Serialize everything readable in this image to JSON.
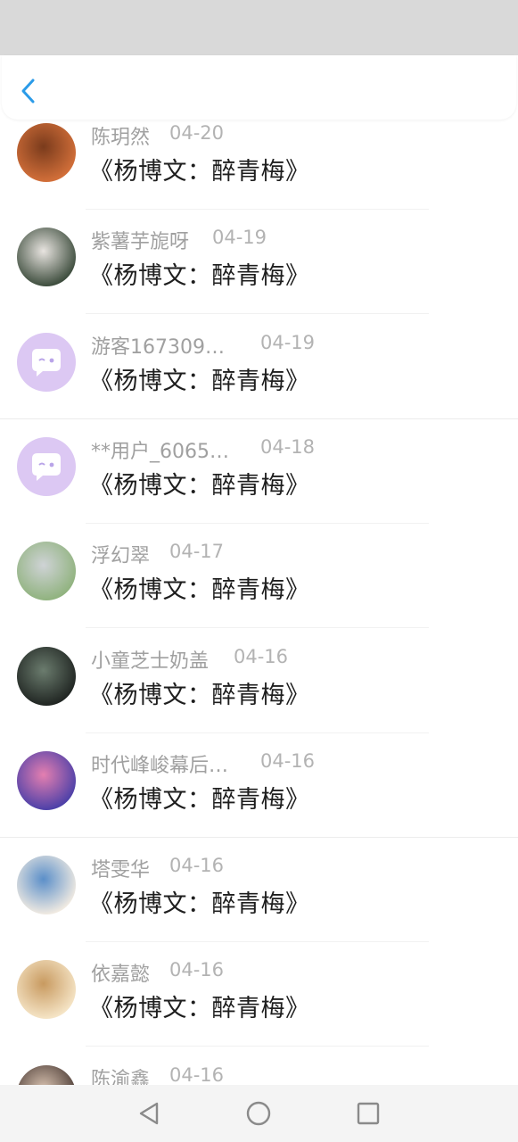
{
  "header": {
    "back_icon": "chevron-left-icon",
    "accent": "#2b9be8"
  },
  "comments": [
    {
      "name": "陈玥然",
      "date": "04-20",
      "text": "《杨博文：醉青梅》",
      "avatar": "photo",
      "avatar_colors": [
        "#d4703a",
        "#7a3b1c"
      ]
    },
    {
      "name": "紫薯芋旎呀",
      "date": "04-19",
      "text": "《杨博文：醉青梅》",
      "avatar": "photo",
      "avatar_colors": [
        "#3a4a3a",
        "#e8e4e0"
      ]
    },
    {
      "name": "游客167309…",
      "date": "04-19",
      "text": "《杨博文：醉青梅》",
      "avatar": "default",
      "avatar_colors": [
        "#dcc8f3",
        "#ffffff"
      ]
    },
    {
      "name": "**用户_6065…",
      "date": "04-18",
      "text": "《杨博文：醉青梅》",
      "avatar": "default",
      "avatar_colors": [
        "#dcc8f3",
        "#ffffff"
      ]
    },
    {
      "name": "浮幻翠",
      "date": "04-17",
      "text": "《杨博文：醉青梅》",
      "avatar": "photo",
      "avatar_colors": [
        "#8fb27d",
        "#cfd3d6"
      ]
    },
    {
      "name": "小童芝士奶盖",
      "date": "04-16",
      "text": "《杨博文：醉青梅》",
      "avatar": "photo",
      "avatar_colors": [
        "#1f2421",
        "#6b7c6e"
      ]
    },
    {
      "name": "时代峰峻幕后…",
      "date": "04-16",
      "text": "《杨博文：醉青梅》",
      "avatar": "photo",
      "avatar_colors": [
        "#4a3fa8",
        "#e47fb0"
      ]
    },
    {
      "name": "塔雯华",
      "date": "04-16",
      "text": "《杨博文：醉青梅》",
      "avatar": "photo",
      "avatar_colors": [
        "#f3ece2",
        "#5b8fc9"
      ]
    },
    {
      "name": "依嘉懿",
      "date": "04-16",
      "text": "《杨博文：醉青梅》",
      "avatar": "photo",
      "avatar_colors": [
        "#f6e6c8",
        "#c89a60"
      ]
    },
    {
      "name": "陈渝鑫",
      "date": "04-16",
      "text": "",
      "avatar": "photo",
      "avatar_colors": [
        "#4a3a34",
        "#d8c2b0"
      ]
    }
  ],
  "nav": {
    "back_icon": "triangle-back-icon",
    "home_icon": "circle-home-icon",
    "recents_icon": "square-recents-icon"
  }
}
